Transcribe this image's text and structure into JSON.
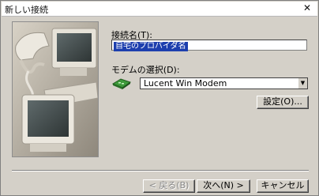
{
  "window": {
    "title": "新しい接続",
    "close_glyph": "✕"
  },
  "form": {
    "name_label": "接続名(T):",
    "name_value": "自宅のプロバイダ名",
    "modem_label": "モデムの選択(D):",
    "modem_value": "Lucent Win Modem",
    "settings_label": "設定(O)..."
  },
  "buttons": {
    "back": "< 戻る(B)",
    "next": "次へ(N) >",
    "cancel": "キャンセル"
  },
  "icons": {
    "dropdown": "chevron-down-icon",
    "modem": "modem-icon",
    "illustration": "computer-phone-illustration"
  },
  "colors": {
    "selection": "#1d3fae",
    "dialog_bg": "#d4d0c8"
  }
}
